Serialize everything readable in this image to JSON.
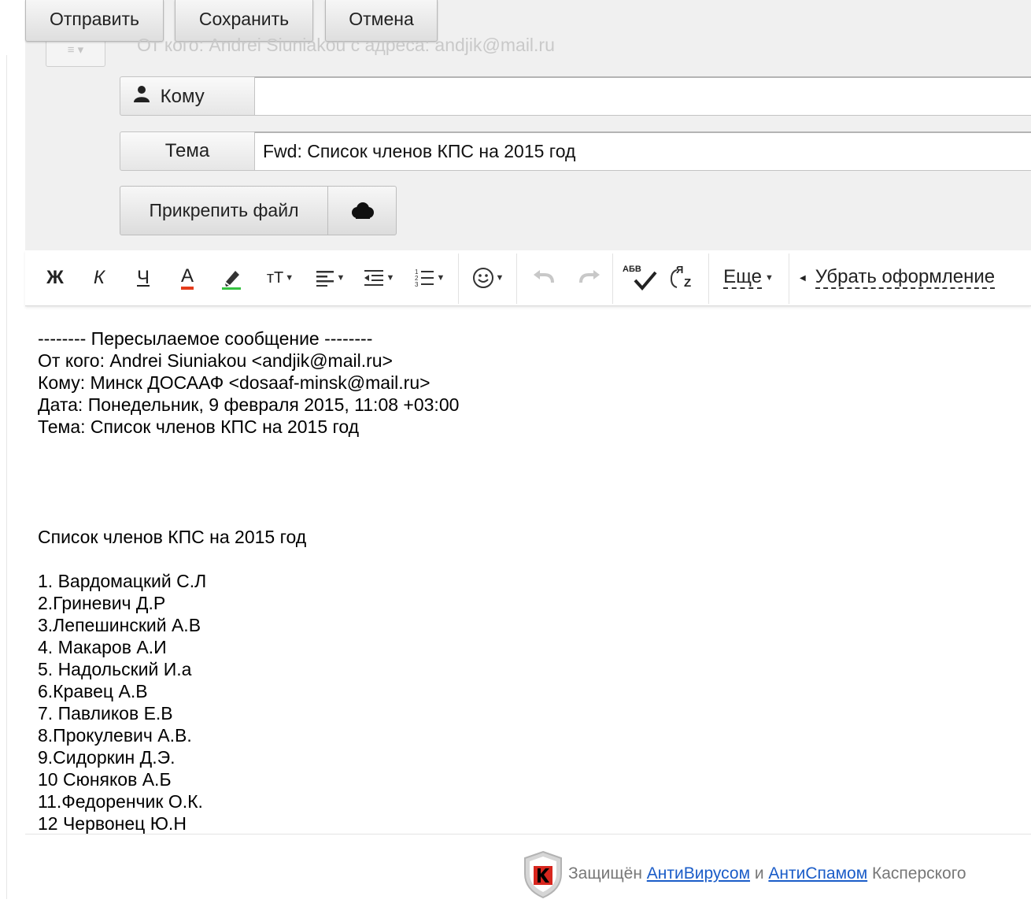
{
  "actions": {
    "send_label": "Отправить",
    "save_label": "Сохранить",
    "cancel_label": "Отмена"
  },
  "from_line": "От кого: Andrei Siuniakou  с адреса: andjik@mail.ru",
  "fields": {
    "to_label": "Кому",
    "to_value": "",
    "subject_label": "Тема",
    "subject_value": "Fwd: Список членов КПС на 2015 год"
  },
  "attach": {
    "attach_label": "Прикрепить файл"
  },
  "toolbar": {
    "bold": "Ж",
    "italic": "К",
    "underline": "Ч",
    "text_color": "А",
    "font_size": "тТ",
    "more_label": "Еще",
    "clear_format_label": "Убрать оформление",
    "spellcheck_label": "АБВ",
    "translit_label_top": "Я",
    "translit_label_bottom": "Z"
  },
  "body_lines": [
    "-------- Пересылаемое сообщение --------",
    "От кого: Andrei Siuniakou <andjik@mail.ru>",
    "Кому: Минск ДОСААФ <dosaaf-minsk@mail.ru>",
    "Дата: Понедельник, 9 февраля 2015, 11:08 +03:00",
    "Тема: Список членов КПС на 2015 год",
    "",
    "",
    "",
    "",
    "Список членов КПС на 2015 год",
    "",
    "1. Вардомацкий С.Л",
    "2.Гриневич Д.Р",
    "3.Лепешинский А.В",
    "4. Макаров А.И",
    "5. Надольский И.а",
    "6.Кравец А.В",
    "7. Павликов Е.В",
    "8.Прокулевич А.В.",
    "9.Сидоркин Д.Э.",
    "10 Сюняков А.Б",
    "11.Федоренчик О.К.",
    "12 Червонец Ю.Н"
  ],
  "footer": {
    "prefix": "Защищён ",
    "antivirus_link": "АнтиВирусом",
    "and": " и ",
    "antispam_link": "АнтиСпамом",
    "suffix": " Касперского"
  },
  "colors": {
    "text_color_underline": "#e53b1b",
    "highlight_underline": "#36c341",
    "link": "#1a5cc8",
    "kaspersky_red": "#d7261e"
  }
}
